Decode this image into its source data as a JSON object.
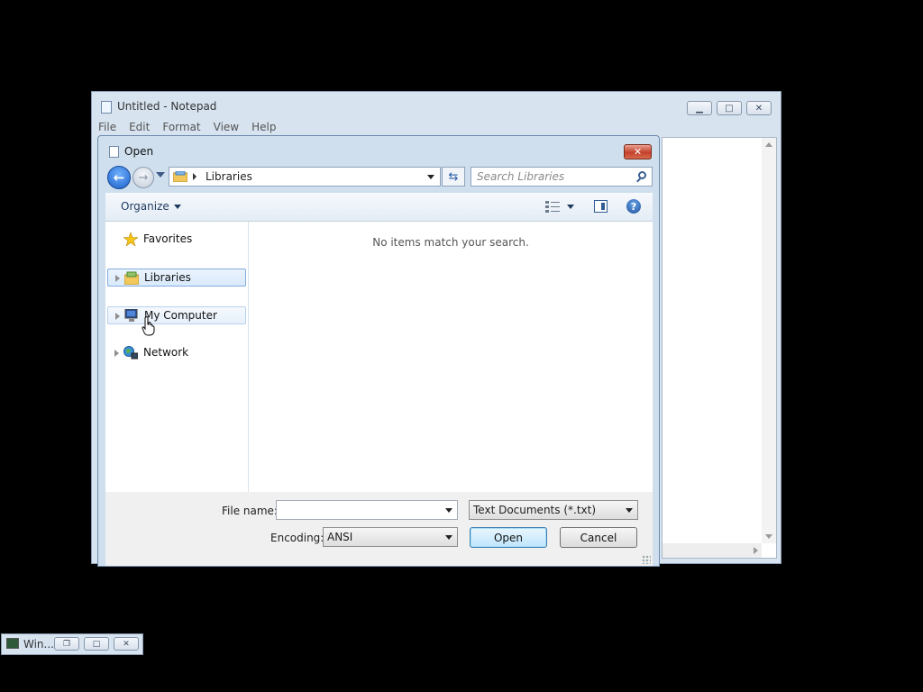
{
  "notepad": {
    "title": "Untitled - Notepad",
    "menu": [
      "File",
      "Edit",
      "Format",
      "View",
      "Help"
    ]
  },
  "dialog": {
    "title": "Open",
    "address": {
      "crumb": "Libraries"
    },
    "search": {
      "placeholder": "Search Libraries"
    },
    "toolbar": {
      "organize_label": "Organize"
    },
    "nav": {
      "items": [
        {
          "label": "Favorites",
          "icon": "star-icon",
          "state": "normal"
        },
        {
          "label": "Libraries",
          "icon": "libraries-icon",
          "state": "selected"
        },
        {
          "label": "My Computer",
          "icon": "computer-icon",
          "state": "hover"
        },
        {
          "label": "Network",
          "icon": "network-icon",
          "state": "normal"
        }
      ]
    },
    "content": {
      "empty_message": "No items match your search."
    },
    "file_name": {
      "label": "File name:",
      "value": ""
    },
    "file_type": {
      "value": "Text Documents (*.txt)"
    },
    "encoding": {
      "label": "Encoding:",
      "value": "ANSI"
    },
    "buttons": {
      "open": "Open",
      "cancel": "Cancel"
    }
  },
  "minimized_window": {
    "title": "Win..."
  },
  "colors": {
    "accent": "#1c5fc7",
    "window_frame": "#cfdfee",
    "close_red": "#c4412b"
  }
}
